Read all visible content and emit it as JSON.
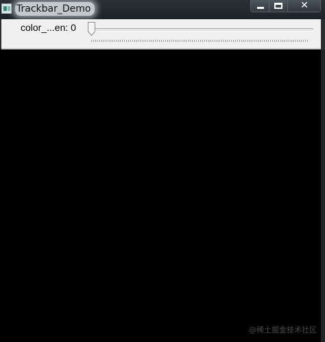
{
  "window": {
    "title": "Trackbar_Demo",
    "controls": {
      "minimize": "minimize-icon",
      "maximize": "maximize-icon",
      "close": "close-icon"
    }
  },
  "trackbar": {
    "label": "color_...en:",
    "value": "0",
    "min": 0,
    "position_fraction": 0
  },
  "canvas": {
    "background": "#000000"
  },
  "watermark": "@稀土掘金技术社区"
}
